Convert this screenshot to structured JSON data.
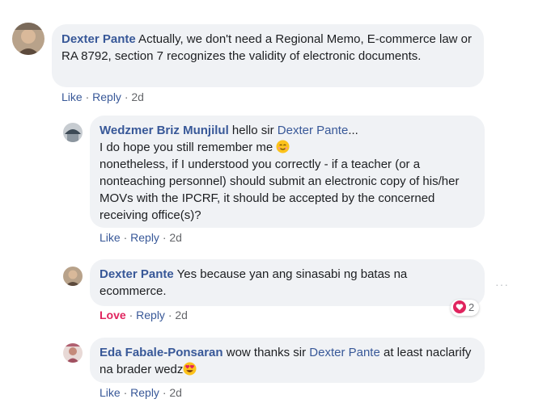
{
  "comments": [
    {
      "author": "Dexter Pante",
      "text": " Actually, we don't need a Regional Memo, E-commerce law or RA 8792, section 7 recognizes the validity of electronic documents.",
      "actions": {
        "like": "Like",
        "reply": "Reply",
        "time": "2d"
      }
    },
    {
      "author": "Wedzmer Briz Munjilul",
      "text_before_mention": " hello sir ",
      "mention": "Dexter Pante",
      "text_after_mention": "...",
      "line2": "I do hope you still remember me ",
      "line2_emoji": "smiling-face-emoji",
      "line3": "nonetheless, if I understood you correctly - if a teacher (or a nonteaching personnel) should submit an electronic copy of his/her MOVs with the IPCRF, it should be accepted by the concerned receiving office(s)?",
      "actions": {
        "like": "Like",
        "reply": "Reply",
        "time": "2d"
      }
    },
    {
      "author": "Dexter Pante",
      "text": " Yes because yan ang sinasabi ng batas na ecommerce.",
      "actions": {
        "like": "Love",
        "reply": "Reply",
        "time": "2d"
      },
      "reactions": {
        "icon": "heart-icon",
        "count": "2",
        "color": "#e0245e"
      }
    },
    {
      "author": "Eda Fabale-Ponsaran",
      "text_before_mention": " wow thanks sir ",
      "mention": "Dexter Pante",
      "text_after_mention": " at least naclarify na brader wedz",
      "emoji": "heart-eyes-emoji",
      "actions": {
        "like": "Like",
        "reply": "Reply",
        "time": "2d"
      }
    }
  ],
  "separator": " · ",
  "more_options": "···",
  "colors": {
    "link": "#385898",
    "love": "#e0245e",
    "bubble": "#f0f2f5"
  }
}
